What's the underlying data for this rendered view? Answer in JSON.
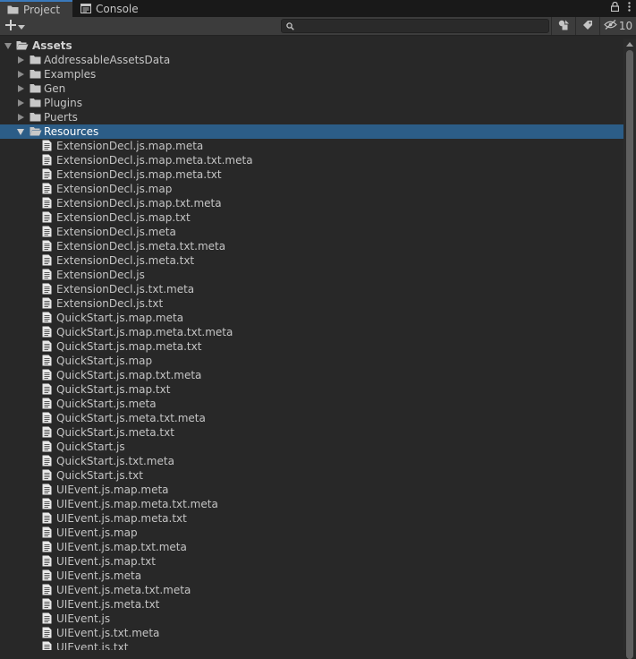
{
  "tabs": {
    "project": "Project",
    "console": "Console"
  },
  "toolbar": {
    "search": {
      "value": "",
      "placeholder": ""
    },
    "hidden_count": "10"
  },
  "root": {
    "label": "Assets"
  },
  "folders": [
    {
      "label": "AddressableAssetsData",
      "expanded": false
    },
    {
      "label": "Examples",
      "expanded": false
    },
    {
      "label": "Gen",
      "expanded": false
    },
    {
      "label": "Plugins",
      "expanded": false
    },
    {
      "label": "Puerts",
      "expanded": false
    },
    {
      "label": "Resources",
      "expanded": true,
      "selected": true
    }
  ],
  "files": [
    "ExtensionDecl.js.map.meta",
    "ExtensionDecl.js.map.meta.txt.meta",
    "ExtensionDecl.js.map.meta.txt",
    "ExtensionDecl.js.map",
    "ExtensionDecl.js.map.txt.meta",
    "ExtensionDecl.js.map.txt",
    "ExtensionDecl.js.meta",
    "ExtensionDecl.js.meta.txt.meta",
    "ExtensionDecl.js.meta.txt",
    "ExtensionDecl.js",
    "ExtensionDecl.js.txt.meta",
    "ExtensionDecl.js.txt",
    "QuickStart.js.map.meta",
    "QuickStart.js.map.meta.txt.meta",
    "QuickStart.js.map.meta.txt",
    "QuickStart.js.map",
    "QuickStart.js.map.txt.meta",
    "QuickStart.js.map.txt",
    "QuickStart.js.meta",
    "QuickStart.js.meta.txt.meta",
    "QuickStart.js.meta.txt",
    "QuickStart.js",
    "QuickStart.js.txt.meta",
    "QuickStart.js.txt",
    "UIEvent.js.map.meta",
    "UIEvent.js.map.meta.txt.meta",
    "UIEvent.js.map.meta.txt",
    "UIEvent.js.map",
    "UIEvent.js.map.txt.meta",
    "UIEvent.js.map.txt",
    "UIEvent.js.meta",
    "UIEvent.js.meta.txt.meta",
    "UIEvent.js.meta.txt",
    "UIEvent.js",
    "UIEvent.js.txt.meta",
    "UIEvent.js.txt"
  ],
  "colors": {
    "selection": "#2c5d87",
    "tab_accent": "#3a79bb",
    "background": "#282828"
  }
}
